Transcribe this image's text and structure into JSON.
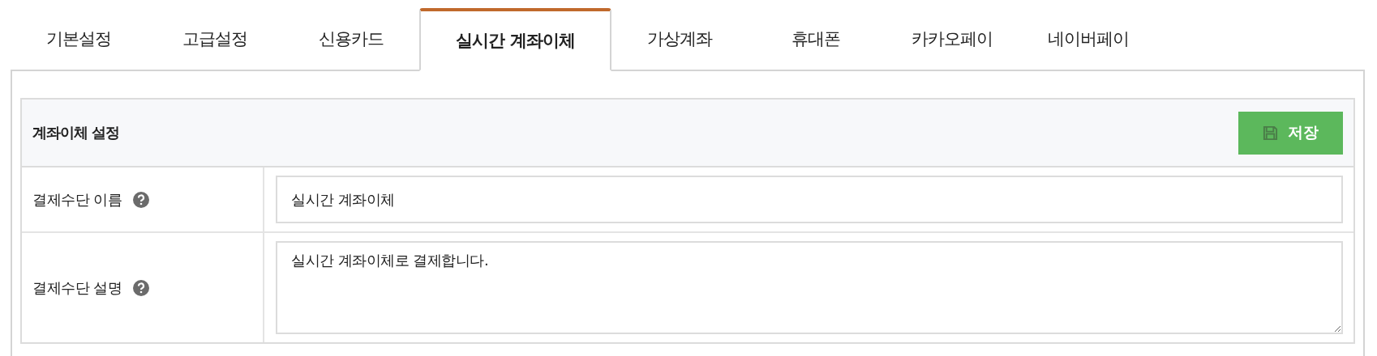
{
  "tabs": [
    {
      "label": "기본설정",
      "selected": false
    },
    {
      "label": "고급설정",
      "selected": false
    },
    {
      "label": "신용카드",
      "selected": false
    },
    {
      "label": "실시간 계좌이체",
      "selected": true
    },
    {
      "label": "가상계좌",
      "selected": false
    },
    {
      "label": "휴대폰",
      "selected": false
    },
    {
      "label": "카카오페이",
      "selected": false
    },
    {
      "label": "네이버페이",
      "selected": false
    }
  ],
  "section": {
    "title": "계좌이체 설정",
    "save_button": "저장"
  },
  "fields": [
    {
      "kind": "input",
      "label": "결제수단 이름",
      "value": "실시간 계좌이체"
    },
    {
      "kind": "textarea",
      "label": "결제수단 설명",
      "value": "실시간 계좌이체로 결제합니다."
    }
  ]
}
